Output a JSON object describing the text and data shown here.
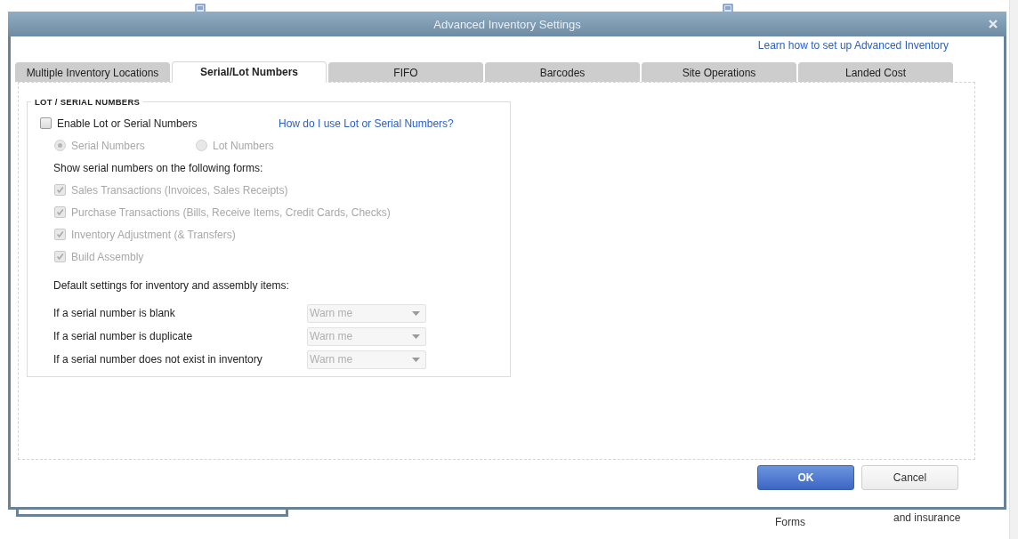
{
  "background": {
    "labels": [
      "Forms",
      "and insurance"
    ]
  },
  "window": {
    "title": "Advanced Inventory Settings"
  },
  "help_link": "Learn how to set up Advanced Inventory",
  "tabs": [
    {
      "label": "Multiple Inventory Locations",
      "selected": false
    },
    {
      "label": "Serial/Lot Numbers",
      "selected": true
    },
    {
      "label": "FIFO",
      "selected": false
    },
    {
      "label": "Barcodes",
      "selected": false
    },
    {
      "label": "Site Operations",
      "selected": false
    },
    {
      "label": "Landed Cost",
      "selected": false
    }
  ],
  "section": {
    "title": "LOT / SERIAL NUMBERS",
    "enable": {
      "label": "Enable Lot or Serial Numbers",
      "checked": false
    },
    "help_link": "How do I use Lot or Serial Numbers?",
    "tracking": [
      {
        "label": "Serial Numbers",
        "selected": true,
        "disabled": true
      },
      {
        "label": "Lot Numbers",
        "selected": false,
        "disabled": true
      }
    ],
    "forms_heading": "Show serial numbers on the following forms:",
    "forms": [
      {
        "label": "Sales Transactions (Invoices, Sales Receipts)",
        "checked": true,
        "disabled": true
      },
      {
        "label": "Purchase Transactions (Bills, Receive Items, Credit Cards, Checks)",
        "checked": true,
        "disabled": true
      },
      {
        "label": "Inventory Adjustment (& Transfers)",
        "checked": true,
        "disabled": true
      },
      {
        "label": "Build Assembly",
        "checked": true,
        "disabled": true
      }
    ],
    "defaults_heading": "Default settings for inventory and assembly items:",
    "defaults": [
      {
        "label": "If a serial number is blank",
        "value": "Warn me",
        "disabled": true
      },
      {
        "label": "If a serial number is duplicate",
        "value": "Warn me",
        "disabled": true
      },
      {
        "label": "If a serial number does not exist in inventory",
        "value": "Warn me",
        "disabled": true
      }
    ]
  },
  "buttons": [
    {
      "label": "OK",
      "kind": "primary"
    },
    {
      "label": "Cancel",
      "kind": "secondary"
    }
  ]
}
